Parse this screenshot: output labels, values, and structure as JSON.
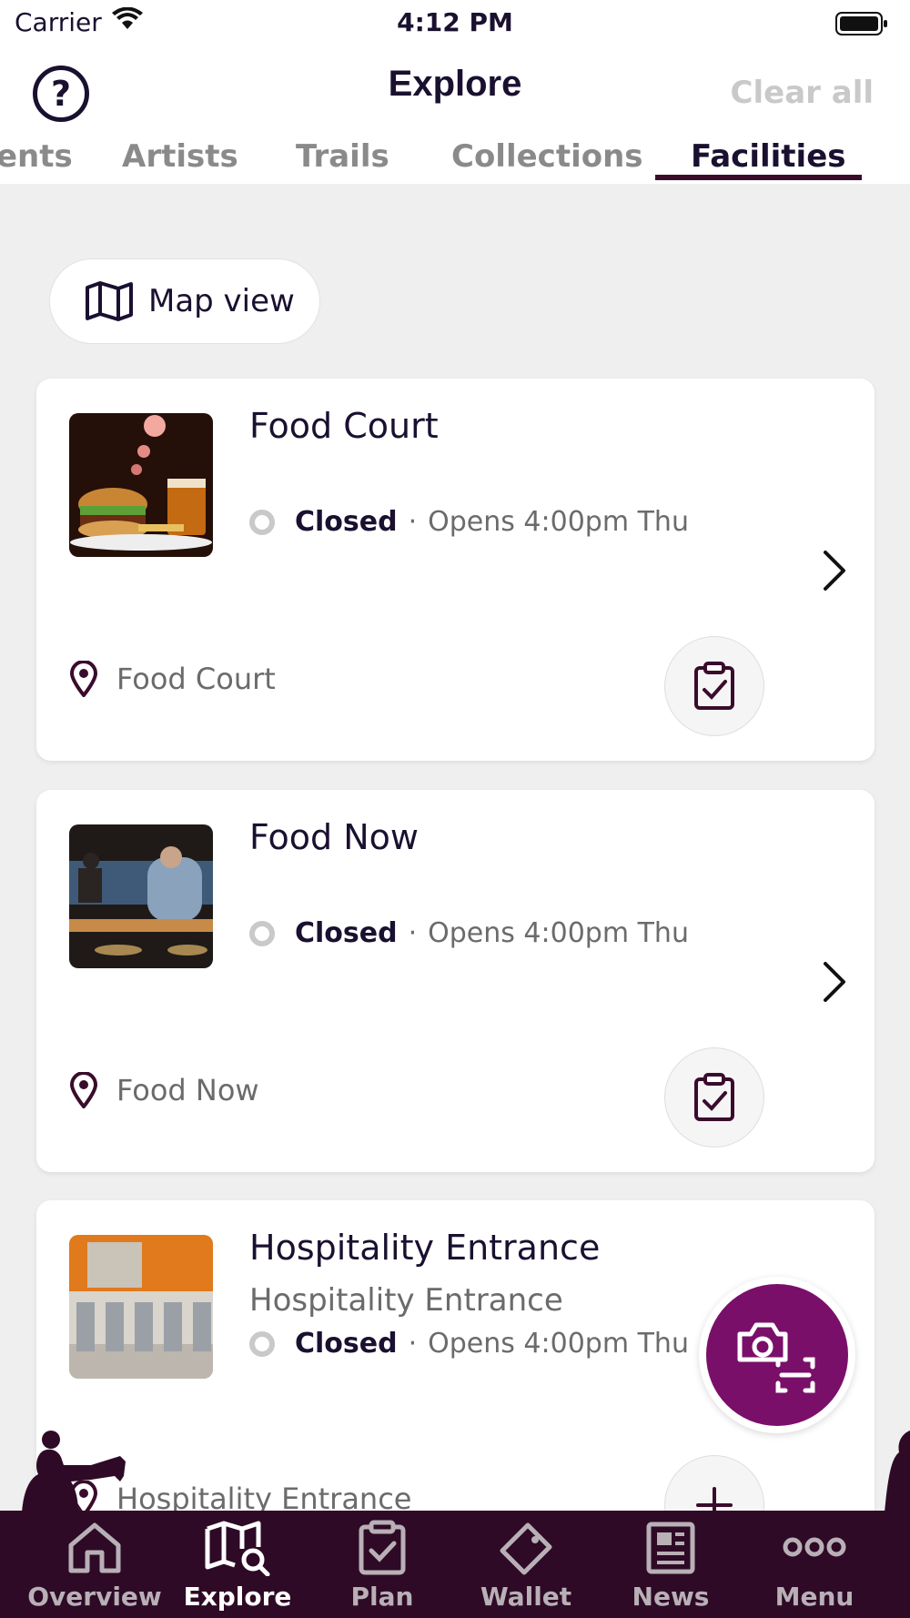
{
  "status_bar": {
    "carrier": "Carrier",
    "time": "4:12 PM"
  },
  "header": {
    "title": "Explore",
    "clear_all": "Clear all",
    "help_icon": "?"
  },
  "tabs": [
    {
      "label": "ents"
    },
    {
      "label": "Artists"
    },
    {
      "label": "Trails"
    },
    {
      "label": "Collections"
    },
    {
      "label": "Facilities",
      "active": true
    }
  ],
  "map_view": {
    "label": "Map view"
  },
  "facilities": [
    {
      "title": "Food Court",
      "subtitle": "",
      "status": "Closed",
      "separator": "·",
      "opens": "Opens 4:00pm Thu",
      "location": "Food Court"
    },
    {
      "title": "Food Now",
      "subtitle": "",
      "status": "Closed",
      "separator": "·",
      "opens": "Opens 4:00pm Thu",
      "location": "Food Now"
    },
    {
      "title": "Hospitality Entrance",
      "subtitle": "Hospitality Entrance",
      "status": "Closed",
      "separator": "·",
      "opens": "Opens 4:00pm Thu",
      "location": "Hospitality Entrance"
    }
  ],
  "bottom_nav": [
    {
      "label": "Overview",
      "icon": "home-icon"
    },
    {
      "label": "Explore",
      "icon": "map-search-icon",
      "active": true
    },
    {
      "label": "Plan",
      "icon": "clipboard-check-icon"
    },
    {
      "label": "Wallet",
      "icon": "ticket-icon"
    },
    {
      "label": "News",
      "icon": "newspaper-icon"
    },
    {
      "label": "Menu",
      "icon": "more-dots-icon"
    }
  ],
  "colors": {
    "brand_dark": "#2e0a26",
    "accent_purple": "#7a0f6a",
    "text_dark": "#1a1030",
    "muted": "#6b6b6b"
  }
}
